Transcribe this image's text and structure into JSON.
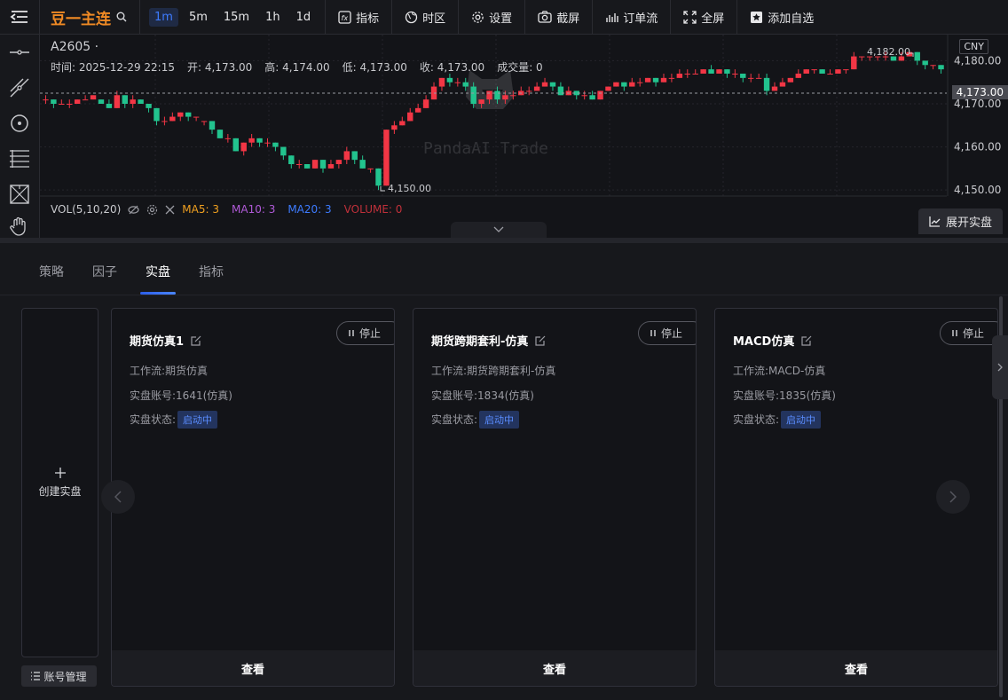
{
  "topbar": {
    "symbol": "豆一主连",
    "intervals": [
      "1m",
      "5m",
      "15m",
      "1h",
      "1d"
    ],
    "active_interval": "1m",
    "tools": {
      "indicators": "指标",
      "timezone": "时区",
      "settings": "设置",
      "screenshot": "截屏",
      "order_flow": "订单流",
      "fullscreen": "全屏",
      "add_watchlist": "添加自选"
    }
  },
  "chart": {
    "contract": "A2605 ·",
    "ohlc": {
      "time": "时间: 2025-12-29 22:15",
      "open": "开: 4,173.00",
      "high": "高: 4,174.00",
      "low": "低: 4,173.00",
      "close": "收: 4,173.00",
      "volume": "成交量: 0"
    },
    "currency": "CNY",
    "current_price": "4,173.00",
    "watermark": "PandaAI Trade",
    "high_marker": "4,182.00",
    "low_marker": "4,150.00",
    "vol": {
      "label": "VOL(5,10,20)",
      "ma5": "MA5: 3",
      "ma10": "MA10: 3",
      "ma20": "MA20: 3",
      "volume": "VOLUME: 0"
    },
    "expand_label": "展开实盘",
    "colors": {
      "up": "#f23645",
      "down": "#22c38e",
      "ma5": "#f0a020",
      "ma10": "#b05ad8",
      "ma20": "#3d7bff",
      "volume": "#c0303a"
    }
  },
  "chart_data": {
    "type": "candlestick",
    "y_ticks": [
      "4,180.00",
      "4,170.00",
      "4,160.00",
      "4,150.00"
    ],
    "ylim": [
      4149,
      4184
    ],
    "candles": [
      [
        4171,
        4171,
        4170,
        4172
      ],
      [
        4171,
        4170,
        4169,
        4171
      ],
      [
        4170,
        4170,
        4170,
        4171
      ],
      [
        4170,
        4170,
        4169,
        4171
      ],
      [
        4170,
        4171,
        4170,
        4171
      ],
      [
        4171,
        4171,
        4171,
        4172
      ],
      [
        4171,
        4172,
        4171,
        4172
      ],
      [
        4171,
        4170,
        4170,
        4171
      ],
      [
        4170,
        4169,
        4169,
        4171
      ],
      [
        4169,
        4172,
        4169,
        4173
      ],
      [
        4172,
        4170,
        4169,
        4172
      ],
      [
        4170,
        4171,
        4169,
        4172
      ],
      [
        4171,
        4170,
        4170,
        4171
      ],
      [
        4170,
        4169,
        4168,
        4170
      ],
      [
        4169,
        4166,
        4165,
        4169
      ],
      [
        4166,
        4166,
        4165,
        4167
      ],
      [
        4166,
        4167,
        4166,
        4168
      ],
      [
        4167,
        4168,
        4166,
        4168
      ],
      [
        4168,
        4167,
        4166,
        4168
      ],
      [
        4167,
        4167,
        4166,
        4167
      ],
      [
        4166,
        4166,
        4165,
        4166
      ],
      [
        4166,
        4164,
        4163,
        4166
      ],
      [
        4164,
        4162,
        4162,
        4164
      ],
      [
        4162,
        4162,
        4161,
        4163
      ],
      [
        4162,
        4159,
        4159,
        4162
      ],
      [
        4159,
        4161,
        4158,
        4161
      ],
      [
        4161,
        4162,
        4160,
        4163
      ],
      [
        4162,
        4161,
        4160,
        4162
      ],
      [
        4161,
        4161,
        4160,
        4162
      ],
      [
        4161,
        4160,
        4159,
        4161
      ],
      [
        4160,
        4158,
        4157,
        4160
      ],
      [
        4158,
        4156,
        4155,
        4158
      ],
      [
        4156,
        4156,
        4155,
        4157
      ],
      [
        4156,
        4155,
        4155,
        4156
      ],
      [
        4155,
        4157,
        4155,
        4157
      ],
      [
        4157,
        4155,
        4154,
        4157
      ],
      [
        4155,
        4156,
        4155,
        4157
      ],
      [
        4156,
        4157,
        4155,
        4157
      ],
      [
        4157,
        4159,
        4156,
        4160
      ],
      [
        4159,
        4157,
        4156,
        4159
      ],
      [
        4157,
        4155,
        4155,
        4158
      ],
      [
        4155,
        4155,
        4154,
        4155
      ],
      [
        4155,
        4151,
        4150,
        4155
      ],
      [
        4151,
        4164,
        4151,
        4164
      ],
      [
        4164,
        4165,
        4163,
        4166
      ],
      [
        4165,
        4166,
        4165,
        4167
      ],
      [
        4166,
        4168,
        4166,
        4169
      ],
      [
        4168,
        4169,
        4168,
        4170
      ],
      [
        4169,
        4171,
        4169,
        4172
      ],
      [
        4171,
        4174,
        4171,
        4175
      ],
      [
        4174,
        4176,
        4173,
        4176
      ],
      [
        4176,
        4175,
        4174,
        4177
      ],
      [
        4175,
        4175,
        4174,
        4176
      ],
      [
        4175,
        4174,
        4173,
        4176
      ],
      [
        4174,
        4170,
        4169,
        4175
      ],
      [
        4170,
        4171,
        4169,
        4171
      ],
      [
        4171,
        4173,
        4170,
        4173
      ],
      [
        4173,
        4171,
        4170,
        4174
      ],
      [
        4171,
        4172,
        4170,
        4173
      ],
      [
        4172,
        4172,
        4171,
        4173
      ],
      [
        4172,
        4173,
        4172,
        4174
      ],
      [
        4173,
        4173,
        4172,
        4174
      ],
      [
        4173,
        4174,
        4173,
        4175
      ],
      [
        4174,
        4175,
        4174,
        4176
      ],
      [
        4175,
        4174,
        4173,
        4175
      ],
      [
        4174,
        4172,
        4172,
        4175
      ],
      [
        4172,
        4173,
        4172,
        4174
      ],
      [
        4173,
        4172,
        4171,
        4173
      ],
      [
        4172,
        4172,
        4171,
        4173
      ],
      [
        4172,
        4171,
        4171,
        4173
      ],
      [
        4171,
        4173,
        4171,
        4173
      ],
      [
        4173,
        4174,
        4173,
        4174
      ],
      [
        4174,
        4175,
        4174,
        4175
      ],
      [
        4175,
        4174,
        4173,
        4175
      ],
      [
        4174,
        4175,
        4174,
        4176
      ],
      [
        4175,
        4175,
        4174,
        4176
      ],
      [
        4175,
        4176,
        4175,
        4176
      ],
      [
        4176,
        4175,
        4174,
        4176
      ],
      [
        4175,
        4176,
        4175,
        4177
      ],
      [
        4176,
        4176,
        4175,
        4177
      ],
      [
        4176,
        4177,
        4176,
        4178
      ],
      [
        4177,
        4177,
        4176,
        4178
      ],
      [
        4177,
        4177,
        4177,
        4178
      ],
      [
        4177,
        4178,
        4177,
        4178
      ],
      [
        4178,
        4177,
        4177,
        4179
      ],
      [
        4177,
        4178,
        4177,
        4178
      ],
      [
        4178,
        4177,
        4176,
        4178
      ],
      [
        4177,
        4177,
        4176,
        4178
      ],
      [
        4177,
        4176,
        4175,
        4177
      ],
      [
        4176,
        4176,
        4175,
        4177
      ],
      [
        4176,
        4176,
        4176,
        4177
      ],
      [
        4176,
        4173,
        4172,
        4177
      ],
      [
        4173,
        4174,
        4173,
        4175
      ],
      [
        4174,
        4175,
        4174,
        4176
      ],
      [
        4175,
        4176,
        4175,
        4176
      ],
      [
        4176,
        4177,
        4176,
        4178
      ],
      [
        4177,
        4178,
        4177,
        4178
      ],
      [
        4178,
        4178,
        4177,
        4178
      ],
      [
        4178,
        4177,
        4177,
        4178
      ],
      [
        4177,
        4177,
        4177,
        4178
      ],
      [
        4177,
        4178,
        4177,
        4178
      ],
      [
        4178,
        4178,
        4177,
        4178
      ],
      [
        4178,
        4181,
        4178,
        4182
      ],
      [
        4181,
        4181,
        4180,
        4181
      ],
      [
        4181,
        4181,
        4180,
        4181
      ],
      [
        4181,
        4181,
        4180,
        4181
      ],
      [
        4181,
        4181,
        4180,
        4182
      ],
      [
        4181,
        4180,
        4180,
        4181
      ],
      [
        4180,
        4181,
        4180,
        4182
      ],
      [
        4181,
        4182,
        4181,
        4182
      ],
      [
        4182,
        4180,
        4179,
        4182
      ],
      [
        4180,
        4179,
        4178,
        4180
      ],
      [
        4179,
        4179,
        4178,
        4179
      ],
      [
        4179,
        4178,
        4177,
        4179
      ]
    ]
  },
  "panel": {
    "tabs": [
      "策略",
      "因子",
      "实盘",
      "指标"
    ],
    "active_tab": "实盘",
    "create_label": "创建实盘",
    "account_btn": "账号管理",
    "stop_label": "停止",
    "view_label": "查看",
    "workflow_prefix": "工作流:",
    "account_prefix": "实盘账号:",
    "status_prefix": "实盘状态:",
    "cards": [
      {
        "title": "期货仿真1",
        "workflow": "期货仿真",
        "account": "1641(仿真)",
        "status": "启动中"
      },
      {
        "title": "期货跨期套利-仿真",
        "workflow": "期货跨期套利-仿真",
        "account": "1834(仿真)",
        "status": "启动中"
      },
      {
        "title": "MACD仿真",
        "workflow": "MACD-仿真",
        "account": "1835(仿真)",
        "status": "启动中"
      }
    ]
  }
}
